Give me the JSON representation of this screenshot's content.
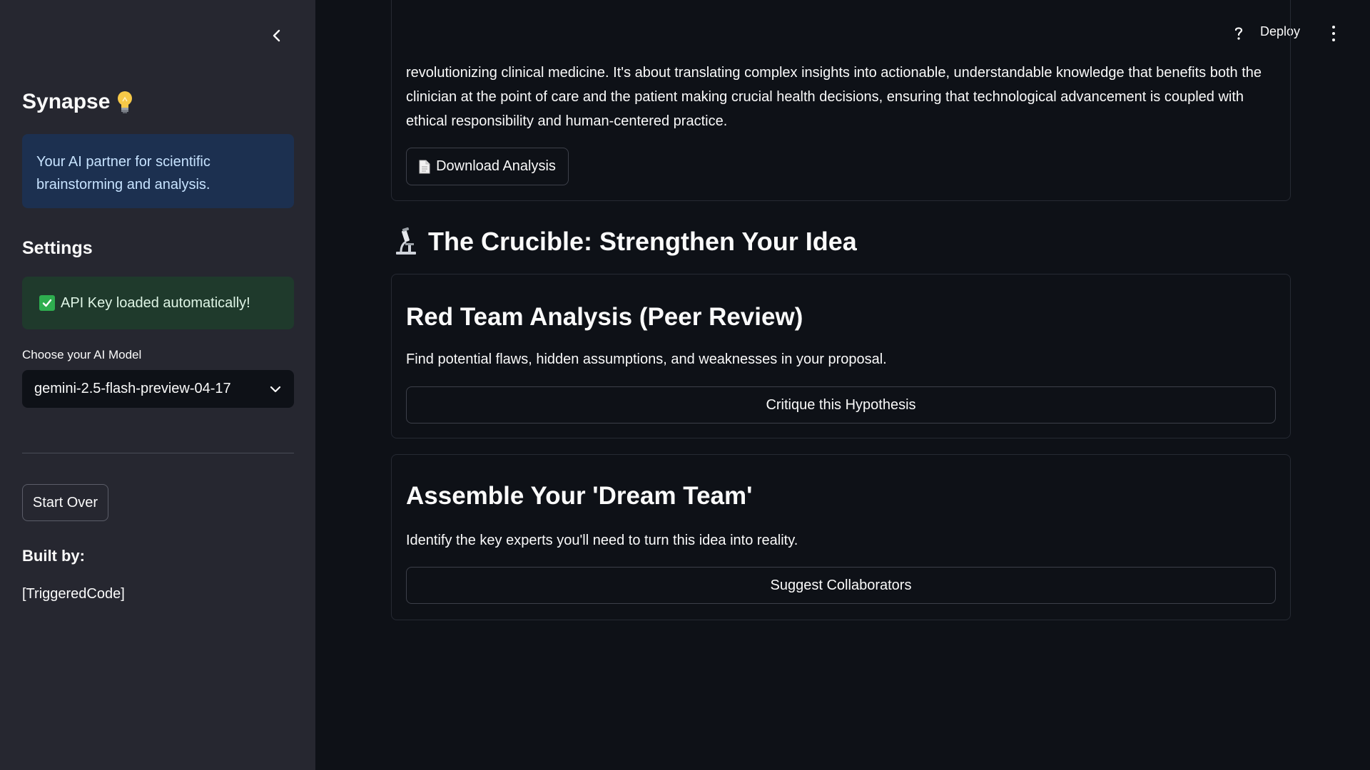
{
  "sidebar": {
    "title": "Synapse",
    "tagline": "Your AI partner for scientific brainstorming and analysis.",
    "settings_heading": "Settings",
    "api_status": "API Key loaded automatically!",
    "model_label": "Choose your AI Model",
    "model_selected": "gemini-2.5-flash-preview-04-17",
    "start_over_label": "Start Over",
    "built_by_label": "Built by:",
    "author": "[TriggeredCode]"
  },
  "topbar": {
    "deploy_label": "Deploy"
  },
  "analysis": {
    "text": "revolutionizing clinical medicine. It's about translating complex insights into actionable, understandable knowledge that benefits both the clinician at the point of care and the patient making crucial health decisions, ensuring that technological advancement is coupled with ethical responsibility and human-centered practice.",
    "download_label": "Download Analysis"
  },
  "crucible": {
    "heading": "The Crucible: Strengthen Your Idea",
    "red_team": {
      "title": "Red Team Analysis (Peer Review)",
      "description": "Find potential flaws, hidden assumptions, and weaknesses in your proposal.",
      "button_label": "Critique this Hypothesis"
    },
    "dream_team": {
      "title": "Assemble Your 'Dream Team'",
      "description": "Identify the key experts you'll need to turn this idea into reality.",
      "button_label": "Suggest Collaborators"
    }
  },
  "colors": {
    "background": "#0e1117",
    "sidebar": "#262730",
    "info_box": "#1c3050",
    "success_box": "#1f3a2c",
    "check": "#2eae4f"
  },
  "icons": {
    "collapse": "chevron-left-icon",
    "title_emoji": "lightbulb-icon",
    "status": "check-icon",
    "select": "chevron-down-icon",
    "download": "document-icon",
    "heading": "microscope-icon",
    "help": "help-icon",
    "menu": "more-vertical-icon"
  }
}
